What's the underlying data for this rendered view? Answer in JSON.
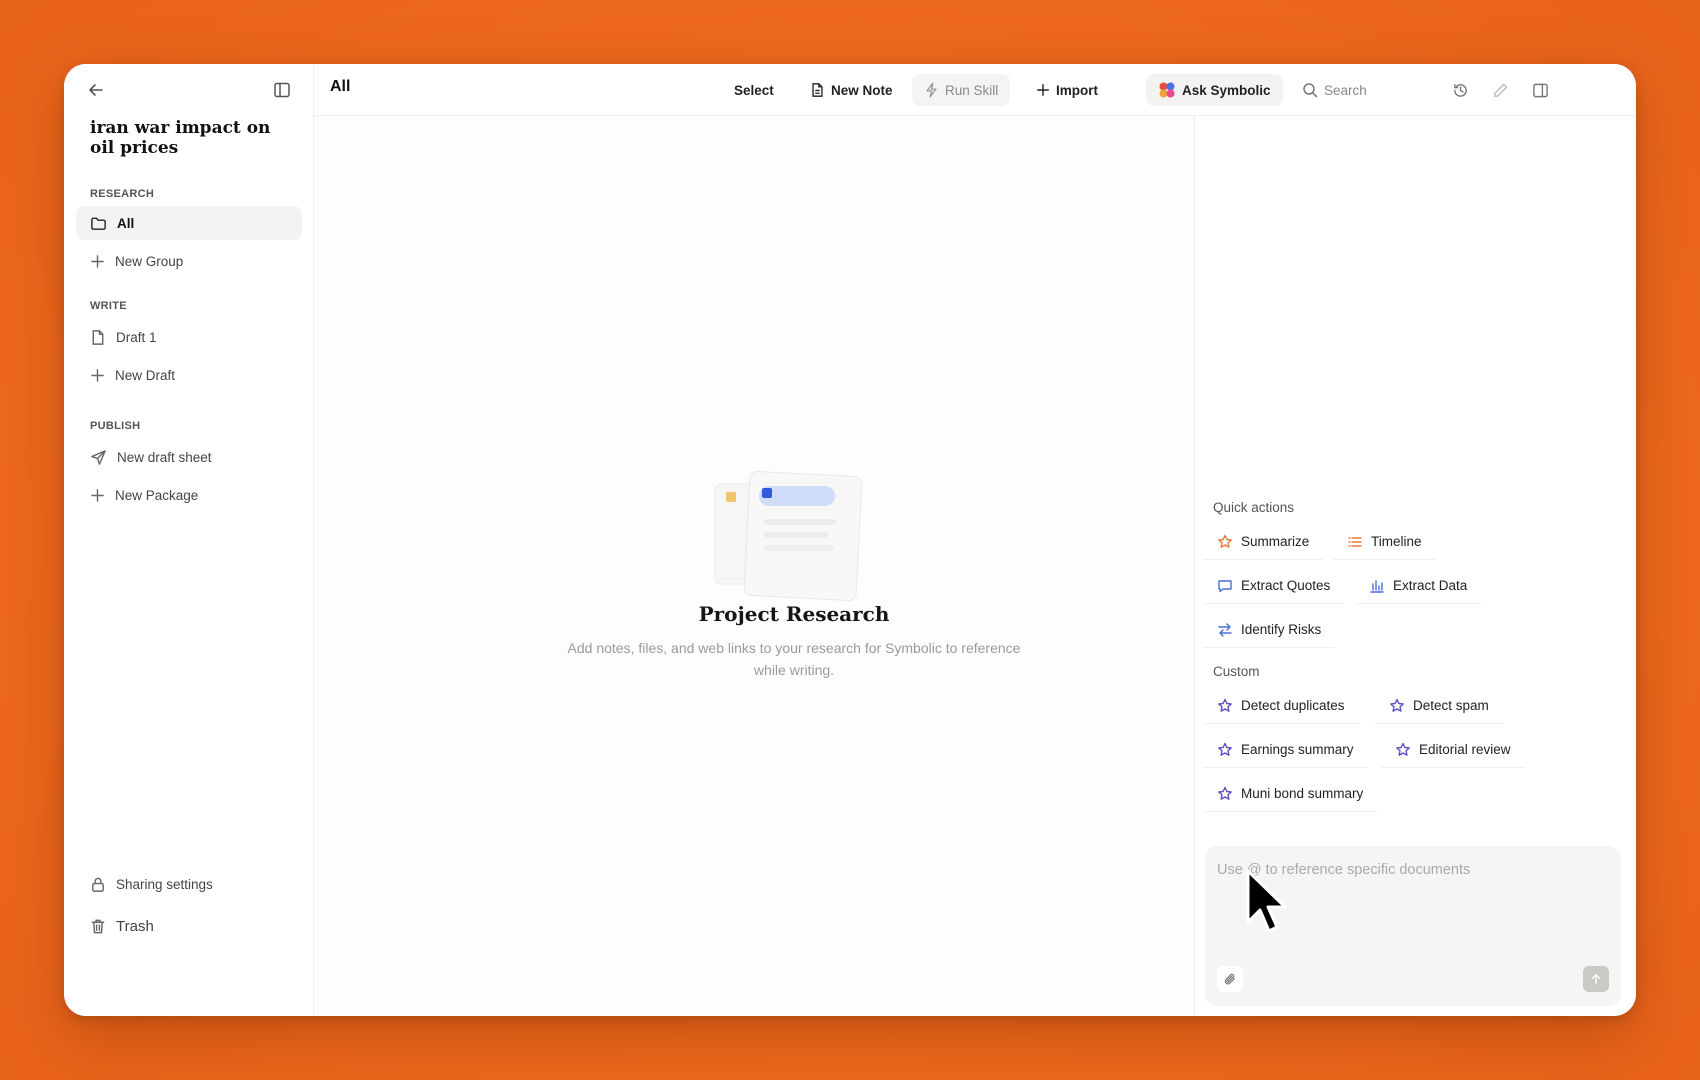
{
  "sidebar": {
    "project_title": "iran war impact on oil prices",
    "sections": {
      "research": "RESEARCH",
      "write": "WRITE",
      "publish": "PUBLISH"
    },
    "items": {
      "all": "All",
      "new_group": "New Group",
      "draft1": "Draft 1",
      "new_draft": "New Draft",
      "new_draft_sheet": "New draft sheet",
      "new_package": "New Package"
    },
    "footer": {
      "sharing": "Sharing settings",
      "trash": "Trash"
    }
  },
  "topbar": {
    "title": "All",
    "select": "Select",
    "new_note": "New Note",
    "run_skill": "Run Skill",
    "import": "Import",
    "ask": "Ask Symbolic",
    "search": "Search"
  },
  "empty_state": {
    "title": "Project Research",
    "description": "Add notes, files, and web links to your research for Symbolic to reference while writing."
  },
  "right_panel": {
    "quick_label": "Quick actions",
    "quick": {
      "summarize": "Summarize",
      "timeline": "Timeline",
      "extract_quotes": "Extract Quotes",
      "extract_data": "Extract Data",
      "identify_risks": "Identify Risks"
    },
    "custom_label": "Custom",
    "custom": {
      "detect_duplicates": "Detect duplicates",
      "detect_spam": "Detect spam",
      "earnings_summary": "Earnings summary",
      "editorial_review": "Editorial review",
      "muni_bond_summary": "Muni bond summary"
    },
    "composer_placeholder": "Use @ to reference specific documents"
  },
  "colors": {
    "background": "#ee6a1d",
    "quick_icon_orange": "#e07a3a",
    "quick_icon_blue": "#4a6fd8",
    "custom_star": "#5a4fc7"
  }
}
